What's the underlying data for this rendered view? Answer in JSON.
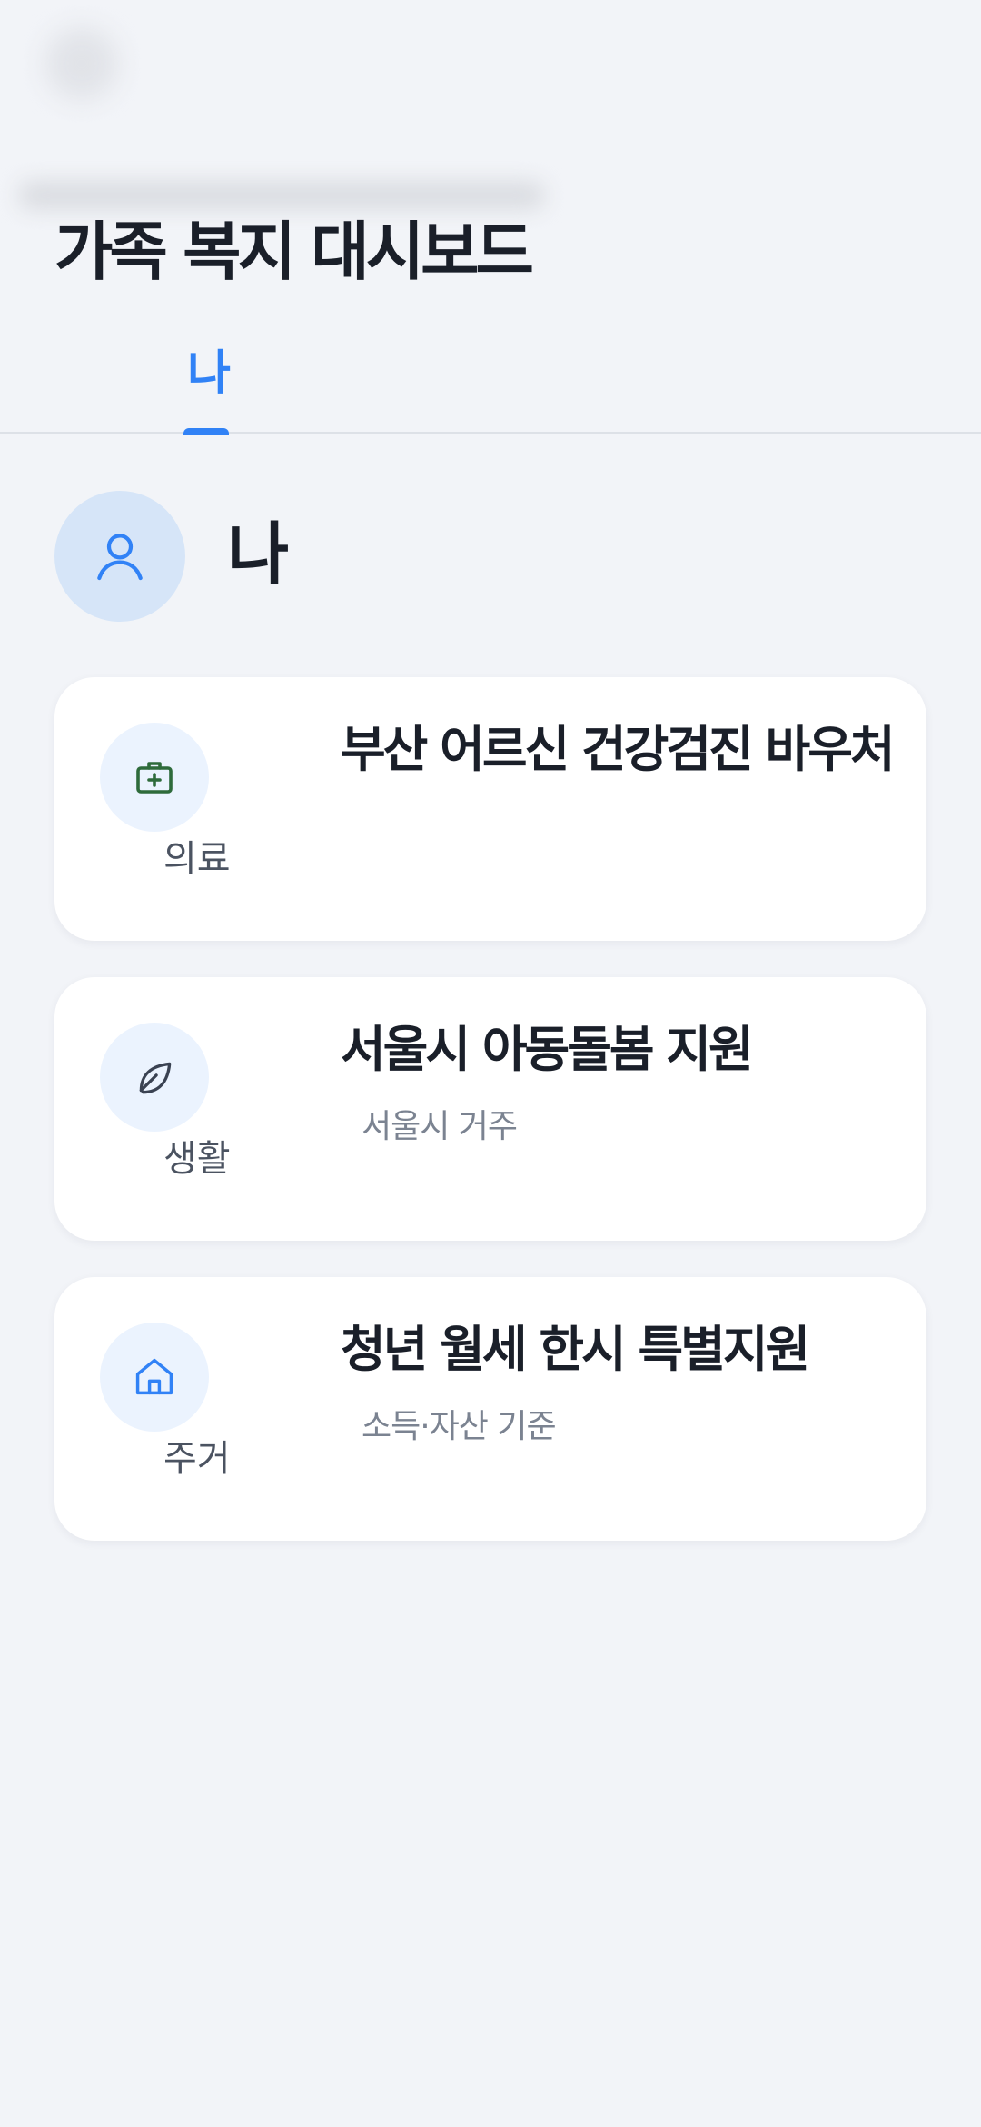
{
  "header": {
    "title": "가족 복지 대시보드",
    "tabs": [
      {
        "label": "나",
        "active": true
      }
    ]
  },
  "profile": {
    "name": "나",
    "icon": "user-icon"
  },
  "cards": [
    {
      "category": "의료",
      "icon": "medical-kit-icon",
      "title": "부산 어르신 건강검진 바우처",
      "subtitle": ""
    },
    {
      "category": "생활",
      "icon": "leaf-icon",
      "title": "서울시 아동돌봄 지원",
      "subtitle": "서울시 거주"
    },
    {
      "category": "주거",
      "icon": "home-icon",
      "title": "청년 월세 한시 특별지원",
      "subtitle": "소득·자산 기준"
    }
  ],
  "colors": {
    "accent": "#3182f6",
    "background": "#f2f4f8",
    "card": "#ffffff",
    "medical_icon": "#2e6b3b",
    "category_icon_bg": "#ebf3fe"
  }
}
